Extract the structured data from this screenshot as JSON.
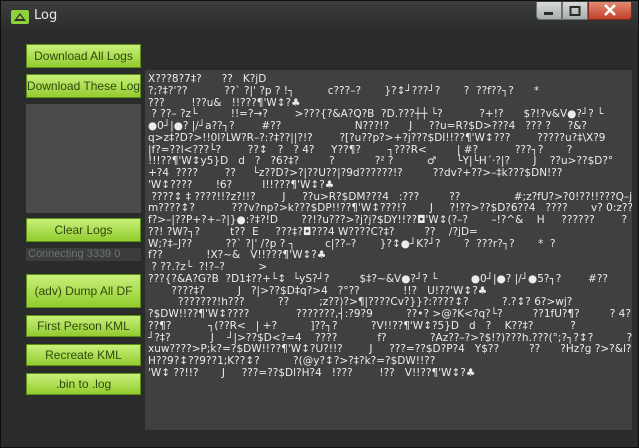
{
  "window": {
    "title": "Log",
    "controls": [
      "minimize-icon",
      "maximize-icon",
      "close-icon"
    ]
  },
  "buttons": {
    "download_all": "Download All Logs",
    "download_these": "Download These Log",
    "clear_logs": "Clear Logs",
    "dump_all_df": "(adv) Dump All DF",
    "first_person_kml": "First Person KML",
    "recreate_kml": "Recreate KML",
    "bin_to_log": ".bin to .log"
  },
  "status": {
    "connection": "Connecting 3339 0"
  },
  "log": {
    "lines": [
      "X???8?7‡?      ??   K?jD",
      "?;?‡?'??           ??` ?|' ?p ? !┐          c???–?       }?↕┘???┘?       ?  ??f??┐?      *",
      "???        !??u&   !!???¶'W↕?♣",
      " ? ??– ?z└          !!=?→?        >???{?&A?Q?B  ?D.???┼┼ └?           ?+!?      $?!?v&V●?┘? └",
      "●0┘|●? |/┘a??┐?        #??                      N???!?      J     ??u=R?$D>???4   ??? ?     ?&?",
      "q>z‡?D?>!!0l?LW?R–?:?‡??||?!?        ?[?u??p?>+?j???$DI!!??¶'W↕???        ?????u?‡\\X?9",
      "|f?=??l<???└?        ??↕   ?   ? 4?     Y??¶?        ┐???R<         | #?           ???┐?       ?",
      "!!!??¶'W↕y5}D   d   ?   ?6?‡?         ?            ?² ?          ♂      └Y|└H´·?|?       J    ??u>??$D?°",
      "+?4  ????        ??     └z??D?>?|??U??|?9d??????!?         ??dv?+??>–‡k???$DN!??",
      "'W↕????       !6?         I!!???¶'W↕?♣",
      " ????↕ ‡ ????!!?z?!!?        J     ??u>R?$DM???4   :???         ??                #;z?fU?>?0!??!!???Q–j?",
      "m????↕?           ???v?np?>k???$DP!!??¶'W↕???!?       J     ?!??>??$D?6??4   ????       v? 0:z??",
      "f?>–|??P+?+–?|}●:?‡?!D       ??!?u???>?j?j?$DY!!??◘'W↕(?–?       –!?^&    H     ??????        ?",
      "??! ?W?┐?         t??  E     ???‡?◘???4 W????C?‡?         ??    /?jD=",
      "W;?‡–J??          ??` ?|' /?p ? ┐         c|??–?       }?↕●┘K?┘?       ?  ???r?┐?       *  ?",
      "f??             !X?~&   V!!???¶'W↕?♣",
      " ? ??.?z└  ?!?–?          >",
      "???{?&A?G?B  ?D1‡??+└↕  └yS?┘?         $‡?~&V●?┘? └          ●0┘|●? |/┘●5?┐?        #??",
      "       ????‡?          J   ?|>??$D‡q?>4   ?°??             !!?   U!??'W↕?♣",
      "         ???????!h???          ??         ;z??)?>¶|????Cv?}}?:????↕?          ?.?↕? 6?>wj?",
      "?$DW!!??¶'W↕????              ???????,┤:?9?9          ??•? >@?K<?q?└?         ??1fU?¶?         ? 4?",
      "??¶?           ┐(??R<   | +?          ]??┐?          ?V!!??¶'W↕?5}D   d   ?    K??‡?           ?",
      "┘?‡?            J    ┘|>??$D<?=4    ????            f?             ?Az??–?>?$!?)???h.???(°;?┐?↕?          ?",
      "xuw????>P;k?=?$DW!!??¶'W↕?U?!!?        J     ???=??$D?P?4   Y$??         ??      ?Hz?g ?>?&l?",
      "H??9?↕??9??1;K??↕?          ?(@y?↕?>?‡?k?=?$DW!!??",
      "'W↕ ??!!?       J     ???=??$Dl?H?4   !???        !??   V!!??¶'W↕?♣"
    ]
  }
}
